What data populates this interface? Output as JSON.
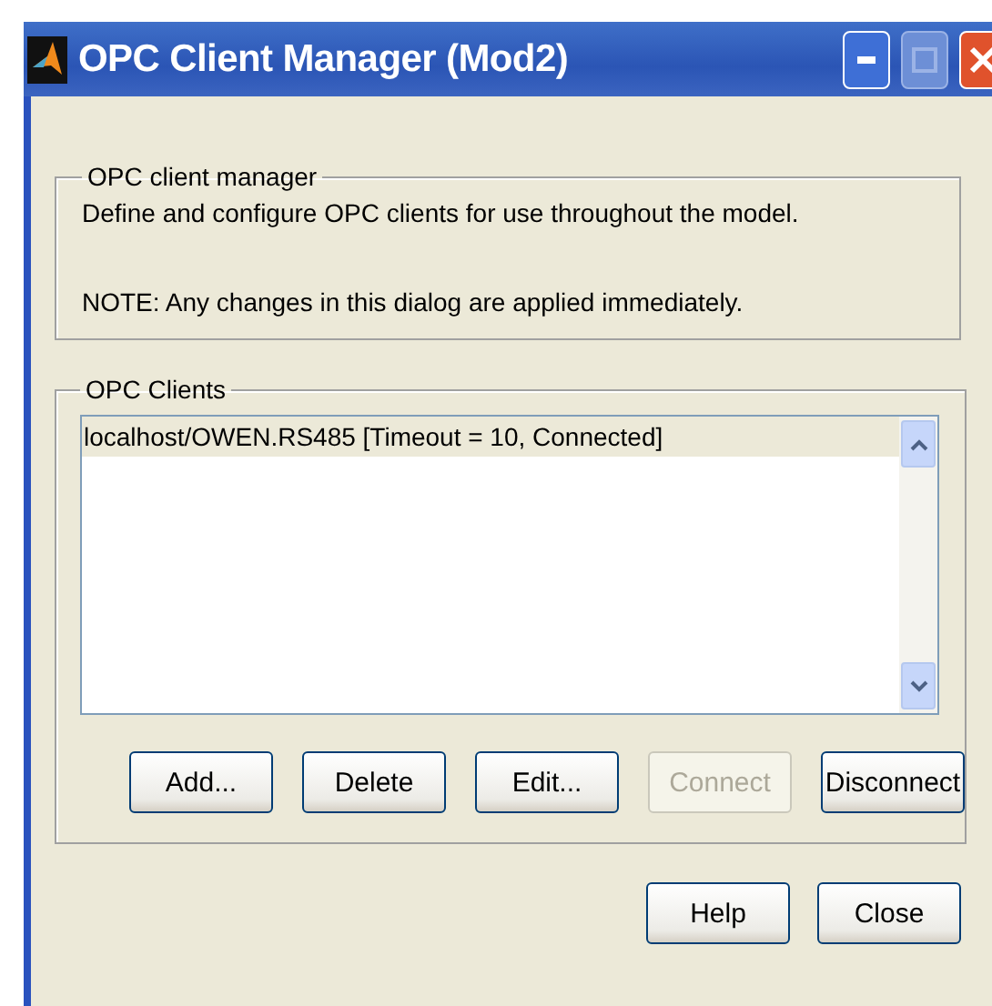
{
  "window": {
    "title": "OPC Client Manager (Mod2)"
  },
  "manager_group": {
    "legend": "OPC client manager",
    "description": "Define and configure OPC clients for use throughout the model.",
    "note": "NOTE: Any changes in this dialog are applied immediately."
  },
  "clients_group": {
    "legend": "OPC Clients",
    "clients": [
      {
        "label": "localhost/OWEN.RS485 [Timeout = 10, Connected]",
        "selected": true
      }
    ],
    "buttons": [
      {
        "label": "Add...",
        "disabled": false
      },
      {
        "label": "Delete",
        "disabled": false
      },
      {
        "label": "Edit...",
        "disabled": false
      },
      {
        "label": "Connect",
        "disabled": true
      },
      {
        "label": "Disconnect",
        "disabled": false
      }
    ]
  },
  "footer_buttons": [
    {
      "label": "Help",
      "disabled": false
    },
    {
      "label": "Close",
      "disabled": false
    }
  ]
}
